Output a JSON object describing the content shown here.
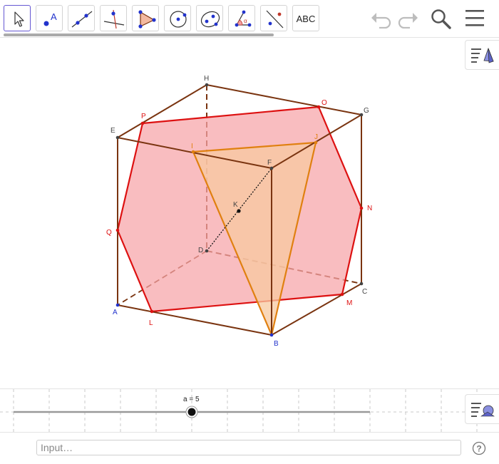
{
  "toolbar": {
    "tools": [
      {
        "name": "move-tool",
        "icon": "arrow-pointer-icon"
      },
      {
        "name": "point-tool",
        "icon": "point-icon",
        "label": "A"
      },
      {
        "name": "line-tool",
        "icon": "line-icon"
      },
      {
        "name": "perpendicular-line-tool",
        "icon": "perpendicular-icon"
      },
      {
        "name": "polygon-tool",
        "icon": "polygon-icon"
      },
      {
        "name": "circle-tool",
        "icon": "circle-icon"
      },
      {
        "name": "ellipse-tool",
        "icon": "ellipse-icon"
      },
      {
        "name": "angle-tool",
        "icon": "angle-icon",
        "label": "α"
      },
      {
        "name": "reflect-tool",
        "icon": "reflect-icon"
      },
      {
        "name": "text-tool",
        "icon": "text-icon",
        "label": "ABC"
      }
    ],
    "undo_icon": "undo-icon",
    "redo_icon": "redo-icon",
    "search_icon": "search-icon",
    "menu_icon": "menu-icon"
  },
  "graphics": {
    "points": {
      "A": "A",
      "B": "B",
      "C": "C",
      "D": "D",
      "E": "E",
      "F": "F",
      "G": "G",
      "H": "H",
      "I": "I",
      "J": "J",
      "K": "K",
      "L": "L",
      "M": "M",
      "N": "N",
      "O": "O",
      "P": "P",
      "Q": "Q"
    },
    "colors": {
      "cube_edge": "#7a3410",
      "hexagon_edge": "#dd1111",
      "hexagon_fill": "#f6a3a7",
      "triangle_edge": "#e08010",
      "triangle_fill": "#f7c9a0",
      "point_blue": "#2233cc",
      "label_red": "#dd1111"
    }
  },
  "slider": {
    "label": "a = 5",
    "value": 5
  },
  "input": {
    "placeholder": "Input…"
  },
  "help_icon": "help-icon"
}
